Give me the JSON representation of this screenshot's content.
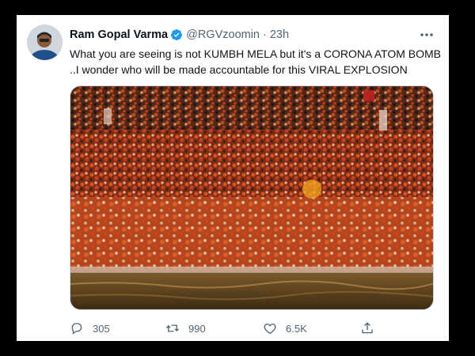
{
  "tweet": {
    "author_name": "Ram Gopal Varma",
    "handle": "@RGVzoomin",
    "separator": "·",
    "time": "23h",
    "text_lines": [
      "What you are seeing is not KUMBH MELA but it's a CORONA ATOM BOMB",
      "..I wonder who will be made accountable for this VIRAL EXPLOSION"
    ],
    "verified": true,
    "accent_color": "#1d9bf0"
  },
  "actions": {
    "reply": {
      "icon": "reply-icon",
      "count": "305"
    },
    "retweet": {
      "icon": "retweet-icon",
      "count": "990"
    },
    "like": {
      "icon": "heart-icon",
      "count": "6.5K"
    },
    "share": {
      "icon": "share-icon"
    }
  },
  "colors": {
    "text": "#0f1419",
    "muted": "#536471",
    "background": "#ffffff",
    "frame": "#000000"
  }
}
